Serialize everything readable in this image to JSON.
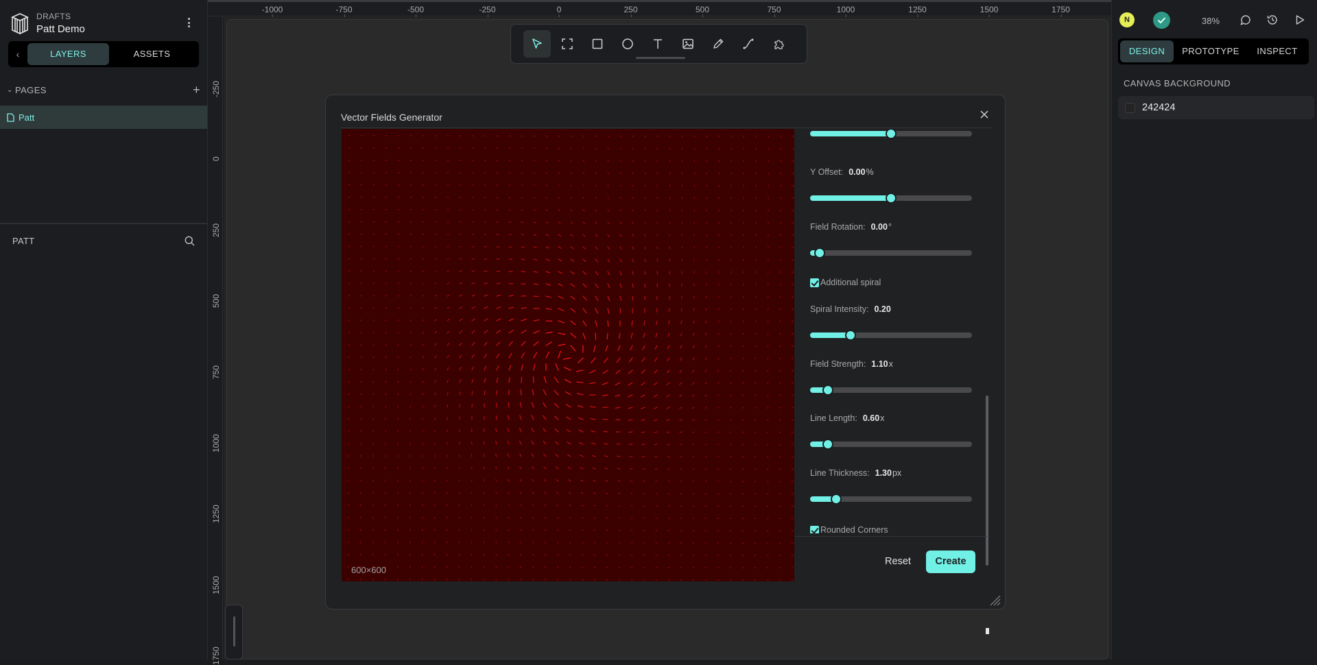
{
  "project": {
    "section": "DRAFTS",
    "name": "Patt Demo",
    "logo_icon": "penpot-logo-icon"
  },
  "left_tabs": {
    "back_icon": "chevron-left-icon",
    "layers": "LAYERS",
    "assets": "ASSETS"
  },
  "pages": {
    "title": "PAGES",
    "items": [
      {
        "label": "Patt",
        "icon": "page-icon"
      }
    ]
  },
  "layers": {
    "title": "PATT",
    "search_icon": "search-icon"
  },
  "rulers": {
    "top_labels": [
      "-1000",
      "-750",
      "-500",
      "-250",
      "0",
      "250",
      "500",
      "750",
      "1000",
      "1250",
      "1500",
      "1750"
    ],
    "left_labels": [
      "-250",
      "0",
      "250",
      "500",
      "750",
      "1000",
      "1250",
      "1500",
      "1750"
    ]
  },
  "toolbar": {
    "tools": [
      "pointer-icon",
      "board-icon",
      "rectangle-icon",
      "ellipse-icon",
      "text-icon",
      "image-icon",
      "pencil-icon",
      "path-icon",
      "plugins-icon"
    ],
    "active_tool": "pointer-icon"
  },
  "dialog": {
    "title": "Vector Fields Generator",
    "preview_size": "600×600",
    "preview_bg": "#3b0000",
    "vector_color": "#ff1a1a",
    "controls": [
      {
        "label": "",
        "value": "",
        "unit": "",
        "fraction": 0.5
      },
      {
        "label": "Y Offset:",
        "value": "0.00",
        "unit": "%",
        "fraction": 0.5
      },
      {
        "label": "Field Rotation:",
        "value": "0.00",
        "unit": "°",
        "fraction": 0.06
      },
      {
        "label": "Spiral Intensity:",
        "value": "0.20",
        "unit": "",
        "fraction": 0.25
      },
      {
        "label": "Field Strength:",
        "value": "1.10",
        "unit": "x",
        "fraction": 0.11
      },
      {
        "label": "Line Length:",
        "value": "0.60",
        "unit": "x",
        "fraction": 0.11
      },
      {
        "label": "Line Thickness:",
        "value": "1.30",
        "unit": "px",
        "fraction": 0.16
      }
    ],
    "additional_spiral": {
      "label": "Additional spiral",
      "checked": true
    },
    "rounded_corners": {
      "label": "Rounded Corners",
      "checked": true
    },
    "reset_label": "Reset",
    "create_label": "Create",
    "accent": "#71f0e6"
  },
  "right_panel": {
    "avatar_initial": "N",
    "zoom": "38%",
    "tabs": [
      "DESIGN",
      "PROTOTYPE",
      "INSPECT"
    ],
    "active_tab": "DESIGN",
    "canvas_background_title": "CANVAS BACKGROUND",
    "canvas_background_value": "242424"
  }
}
